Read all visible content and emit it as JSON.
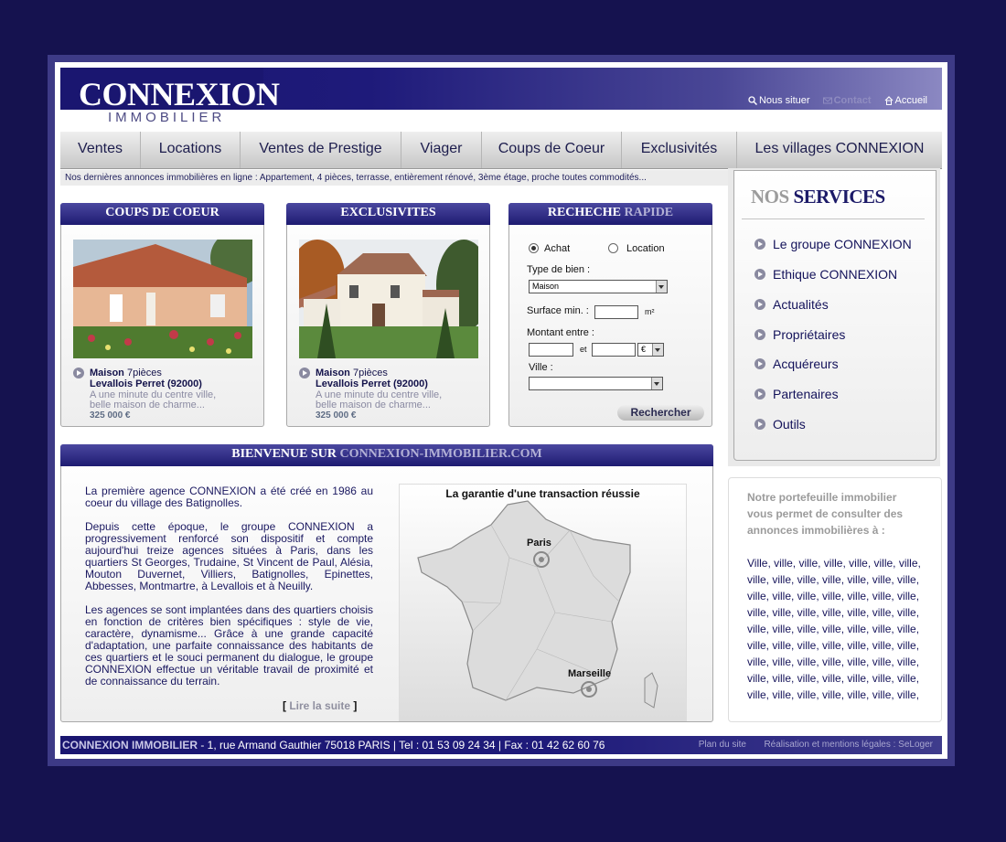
{
  "logo": {
    "name": "CONNEXION",
    "sub": "IMMOBILIER"
  },
  "toplinks": {
    "situer": "Nous situer",
    "contact": "Contact",
    "accueil": "Accueil"
  },
  "nav": [
    "Ventes",
    "Locations",
    "Ventes de Prestige",
    "Viager",
    "Coups de Coeur",
    "Exclusivités",
    "Les villages CONNEXION"
  ],
  "ticker": "Nos dernières annonces immobilières en ligne : Appartement, 4 pièces, terrasse, entièrement rénové, 3ème étage, proche toutes commodités...",
  "coups": {
    "title": "COUPS DE COEUR",
    "type": "Maison",
    "rooms": "7pièces",
    "city": "Levallois Perret (92000)",
    "desc1": "A une minute du centre ville,",
    "desc2": "belle maison de charme...",
    "price": "325 000 €"
  },
  "exclus": {
    "title": "EXCLUSIVITES",
    "type": "Maison",
    "rooms": "7pièces",
    "city": "Levallois Perret (92000)",
    "desc1": "A une minute du centre ville,",
    "desc2": "belle maison de charme...",
    "price": "325 000 €"
  },
  "search": {
    "title1": "RECHECHE",
    "title2": "RAPIDE",
    "achat": "Achat",
    "location": "Location",
    "type_label": "Type de bien :",
    "type_value": "Maison",
    "surface_label": "Surface min. :",
    "surface_unit": "m²",
    "montant_label": "Montant entre :",
    "et": "et",
    "currency": "€",
    "ville_label": "Ville :",
    "button": "Rechercher"
  },
  "services": {
    "title1": "NOS",
    "title2": "SERVICES",
    "items": [
      "Le groupe CONNEXION",
      "Ethique CONNEXION",
      "Actualités",
      "Propriétaires",
      "Acquéreurs",
      "Partenaires",
      "Outils"
    ]
  },
  "portfolio": {
    "title": "Notre portefeuille immobilier vous permet de consulter des annonces immobilières à :",
    "line": "Ville, ville, ville, ville, ville, ville, ville,",
    "line2": "ville, ville, ville, ville, ville, ville, ville,"
  },
  "welcome": {
    "title1": "BIENVENUE SUR",
    "title2": "CONNEXION-IMMOBILIER.COM",
    "p1": "La première agence CONNEXION a été créé en 1986 au coeur du village des Batignolles.",
    "p2": "Depuis cette époque, le groupe CONNEXION a progressivement renforcé son dispositif et compte aujourd'hui treize agences situées à Paris, dans les quartiers St Georges, Trudaine, St Vincent de Paul, Alésia, Mouton Duvernet, Villiers, Batignolles, Epinettes, Abbesses, Montmartre, à Levallois et à Neuilly.",
    "p3": "Les agences se sont implantées dans des quartiers choisis en fonction de critères bien spécifiques : style de vie, caractère, dynamisme... Grâce à une grande capacité d'adaptation, une parfaite connaissance des habitants de ces quartiers et le souci permanent du dialogue, le groupe CONNEXION effectue un véritable travail de proximité et de connaissance du terrain.",
    "more_open": "[",
    "more": "Lire la suite",
    "more_close": "]",
    "map_title": "La garantie d'une transaction réussie",
    "paris": "Paris",
    "marseille": "Marseille"
  },
  "footer": {
    "company": "CONNEXION IMMOBILIER",
    "address": " - 1, rue Armand Gauthier 75018 PARIS  | Tel : 01 53 09 24 34 |  Fax : 01 42 62 60 76",
    "plan": "Plan du site",
    "real": "Réalisation et mentions légales : SeLoger"
  },
  "colors": {
    "background": "#15124f",
    "header": "#1a1670",
    "accent": "#1e1b71"
  }
}
